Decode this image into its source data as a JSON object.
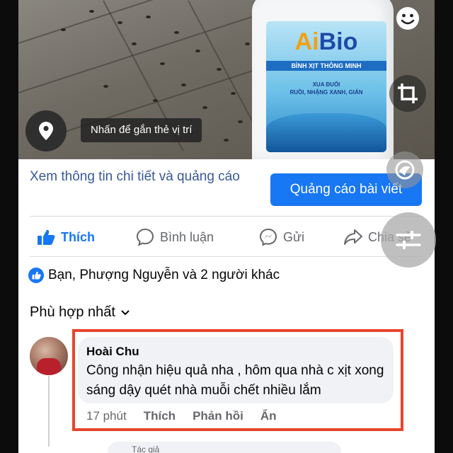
{
  "photo": {
    "product_brand_ai": "Ai",
    "product_brand_bio": "Bio",
    "product_subtitle": "BÌNH XỊT THÔNG MINH",
    "product_claim_1": "XUA ĐUỔI",
    "product_claim_2": "RUỒI, NHẶNG XANH, GIÁN",
    "location_tag": "Nhấn để gắn thẻ vị trí"
  },
  "ad": {
    "info_link": "Xem thông tin chi tiết và quảng cáo",
    "promote_button": "Quảng cáo bài viết"
  },
  "actions": {
    "like": "Thích",
    "comment": "Bình luận",
    "send": "Gửi",
    "share": "Chia sẻ"
  },
  "reactions": {
    "summary": "Bạn, Phượng Nguyễn và 2 người khác"
  },
  "sort": {
    "label": "Phù hợp nhất"
  },
  "comment": {
    "author": "Hoài Chu",
    "text": "Công nhận hiệu quả nha , hôm qua nhà c xịt xong sáng dậy quét nhà muỗi chết nhiều lắm",
    "time": "17 phút",
    "like": "Thích",
    "reply": "Phản hồi",
    "hide": "Ẩn"
  },
  "next_comment": {
    "tag": "Tác giả"
  },
  "colors": {
    "accent": "#1877f2",
    "link": "#385898",
    "highlight_box": "#e8452c"
  },
  "icons": [
    "location-pin-icon",
    "like-thumb-icon",
    "comment-bubble-icon",
    "messenger-icon",
    "share-arrow-icon",
    "chevron-down-icon",
    "emoji-sticker-icon",
    "crop-icon",
    "filter-icon",
    "adjust-sliders-icon"
  ]
}
